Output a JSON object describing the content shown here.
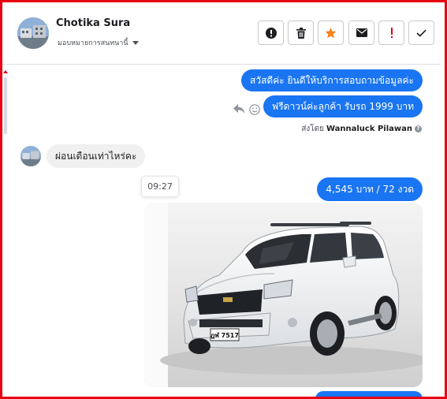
{
  "header": {
    "contact_name": "Chotika Sura",
    "assign_label": "มอบหมายการสนทนานี้",
    "toolbar": [
      {
        "name": "spam-button",
        "icon": "exclamation-circle-icon"
      },
      {
        "name": "delete-button",
        "icon": "trash-icon"
      },
      {
        "name": "star-button",
        "icon": "star-icon",
        "color": "#f5821f"
      },
      {
        "name": "mark-unread-button",
        "icon": "envelope-icon"
      },
      {
        "name": "follow-up-button",
        "icon": "exclamation-icon",
        "color": "#e60012"
      },
      {
        "name": "done-button",
        "icon": "check-icon"
      }
    ]
  },
  "messages": {
    "out1": "สวัสดีค่ะ  ยินดีให้บริการสอบถามข้อมูลค่ะ",
    "out2": "ฟรีดาวน์ค่ะลูกค้า  รับรถ 1999 บาท",
    "sent_by_prefix": "ส่งโดย",
    "sent_by_name": "Wannaluck Pilawan",
    "in1": "ผ่อนเดือนเท่าไหร่คะ",
    "timestamp": "09:27",
    "out3": "4,545 บาท  / 72 งวด",
    "plate": "ฎฬ 7517"
  },
  "colors": {
    "accent": "#1a75f2",
    "frame": "#e60012"
  }
}
